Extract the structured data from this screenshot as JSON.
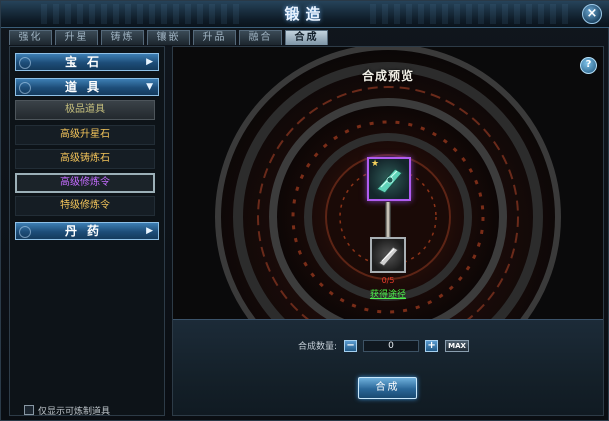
{
  "window": {
    "title": "锻造",
    "close_label": "×"
  },
  "tabs": [
    {
      "label": "强化",
      "active": false
    },
    {
      "label": "升星",
      "active": false
    },
    {
      "label": "铸炼",
      "active": false
    },
    {
      "label": "镶嵌",
      "active": false
    },
    {
      "label": "升品",
      "active": false
    },
    {
      "label": "融合",
      "active": false
    },
    {
      "label": "合成",
      "active": true
    }
  ],
  "sidebar": {
    "categories": [
      {
        "label": "宝石",
        "arrow": "▶"
      },
      {
        "label": "道具",
        "arrow": "▼"
      },
      {
        "label": "丹药",
        "arrow": "▶"
      }
    ],
    "group_label": "极品道具",
    "items": [
      {
        "label": "高级升星石"
      },
      {
        "label": "高级铸炼石"
      },
      {
        "label": "高级修炼令",
        "selected": true
      },
      {
        "label": "特级修炼令"
      }
    ],
    "filter_checkbox": {
      "label": "仅显示可炼制道具",
      "checked": false
    }
  },
  "main": {
    "help_label": "?",
    "preview_title": "合成预览",
    "material_count": "0/5",
    "obtain_link": "获得途径",
    "quantity_label": "合成数量:",
    "quantity_value": "0",
    "minus_label": "−",
    "plus_label": "+",
    "max_label": "MAX",
    "compose_button": "合成"
  },
  "colors": {
    "selected_item_text": "#c56cff",
    "item_text": "#f3c45a",
    "count_text": "#e43a2a",
    "link": "#4cf04a",
    "accent_blue": "#2a6798"
  }
}
